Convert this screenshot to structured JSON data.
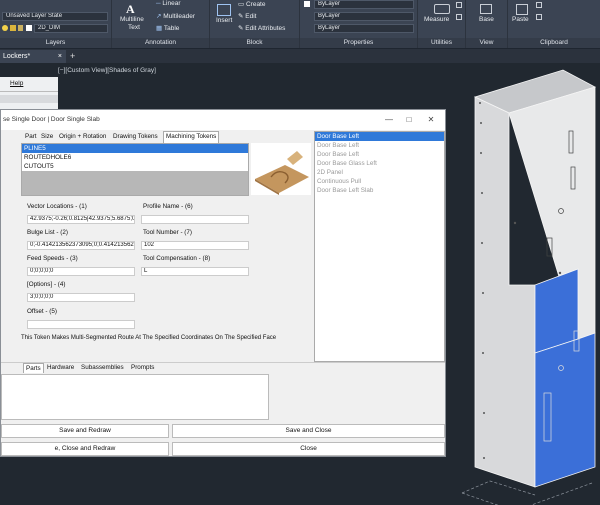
{
  "ribbon": {
    "layer_state": "Unsaved Layer State",
    "layer_name": "2D_DIM",
    "layers_label": "Layers",
    "multiline_text": "Multiline",
    "multiline_text2": "Text",
    "linear": "Linear",
    "multileader": "Multileader",
    "table": "Table",
    "annotation_label": "Annotation",
    "insert": "Insert",
    "create": "Create",
    "edit": "Edit",
    "edit_attributes": "Edit Attributes",
    "block_label": "Block",
    "bylayer1": "ByLayer",
    "bylayer2": "ByLayer",
    "bylayer3": "ByLayer",
    "properties_label": "Properties",
    "measure": "Measure",
    "utilities_label": "Utilities",
    "base": "Base",
    "view_label": "View",
    "paste": "Paste",
    "clipboard_label": "Clipboard"
  },
  "doc_tab": "Lockers*",
  "add_tab": "+",
  "viewport_label": "[−][Custom View][Shades of Gray]",
  "help_menu": "Help",
  "dialog": {
    "title": "se Single Door | Door Single Slab",
    "tabs": [
      "Part",
      "Size",
      "Origin + Rotation",
      "Drawing Tokens",
      "Machining Tokens"
    ],
    "tokens": [
      "PLINE5",
      "ROUTEDHOLE6",
      "CUTOUT5"
    ],
    "fields": {
      "vector_label": "Vector Locations - (1)",
      "vector_value": "42.9375;-0.26;0.8125|42.9375;5.6875;0",
      "bulge_label": "Bulge List - (2)",
      "bulge_value": "0;-0.414213562373095;0;0.41421356237",
      "feed_label": "Feed Speeds - (3)",
      "feed_value": "0;0;0;0;0",
      "options_label": "[Options] - (4)",
      "options_value": "3;0;0;0;0",
      "offset_label": "Offset - (5)",
      "offset_value": "",
      "profile_label": "Profile Name - (6)",
      "profile_value": "",
      "tool_label": "Tool Number - (7)",
      "tool_value": "102",
      "comp_label": "Tool Compensation - (8)",
      "comp_value": "L"
    },
    "description": "This Token Makes  Multi-Segmented Route At The Specified Coordinates On The Specified Face",
    "styles": [
      "Door Base Left",
      "Door Base Left",
      "Door Base Left",
      "Door Base Glass Left",
      "2D Panel",
      "Continuous Pull",
      "Door Base Left Slab"
    ],
    "bottom_tabs": [
      "Parts",
      "Hardware",
      "Subassemblies",
      "Prompts"
    ],
    "buttons": {
      "save_redraw": "Save and Redraw",
      "save_close": "Save and Close",
      "close_redraw": "e, Close and Redraw",
      "close": "Close"
    }
  },
  "colors": {
    "accent": "#2f79d9",
    "ribbon": "#3b4453",
    "viewport": "#212830",
    "selection_blue": "#3b6fd8"
  }
}
